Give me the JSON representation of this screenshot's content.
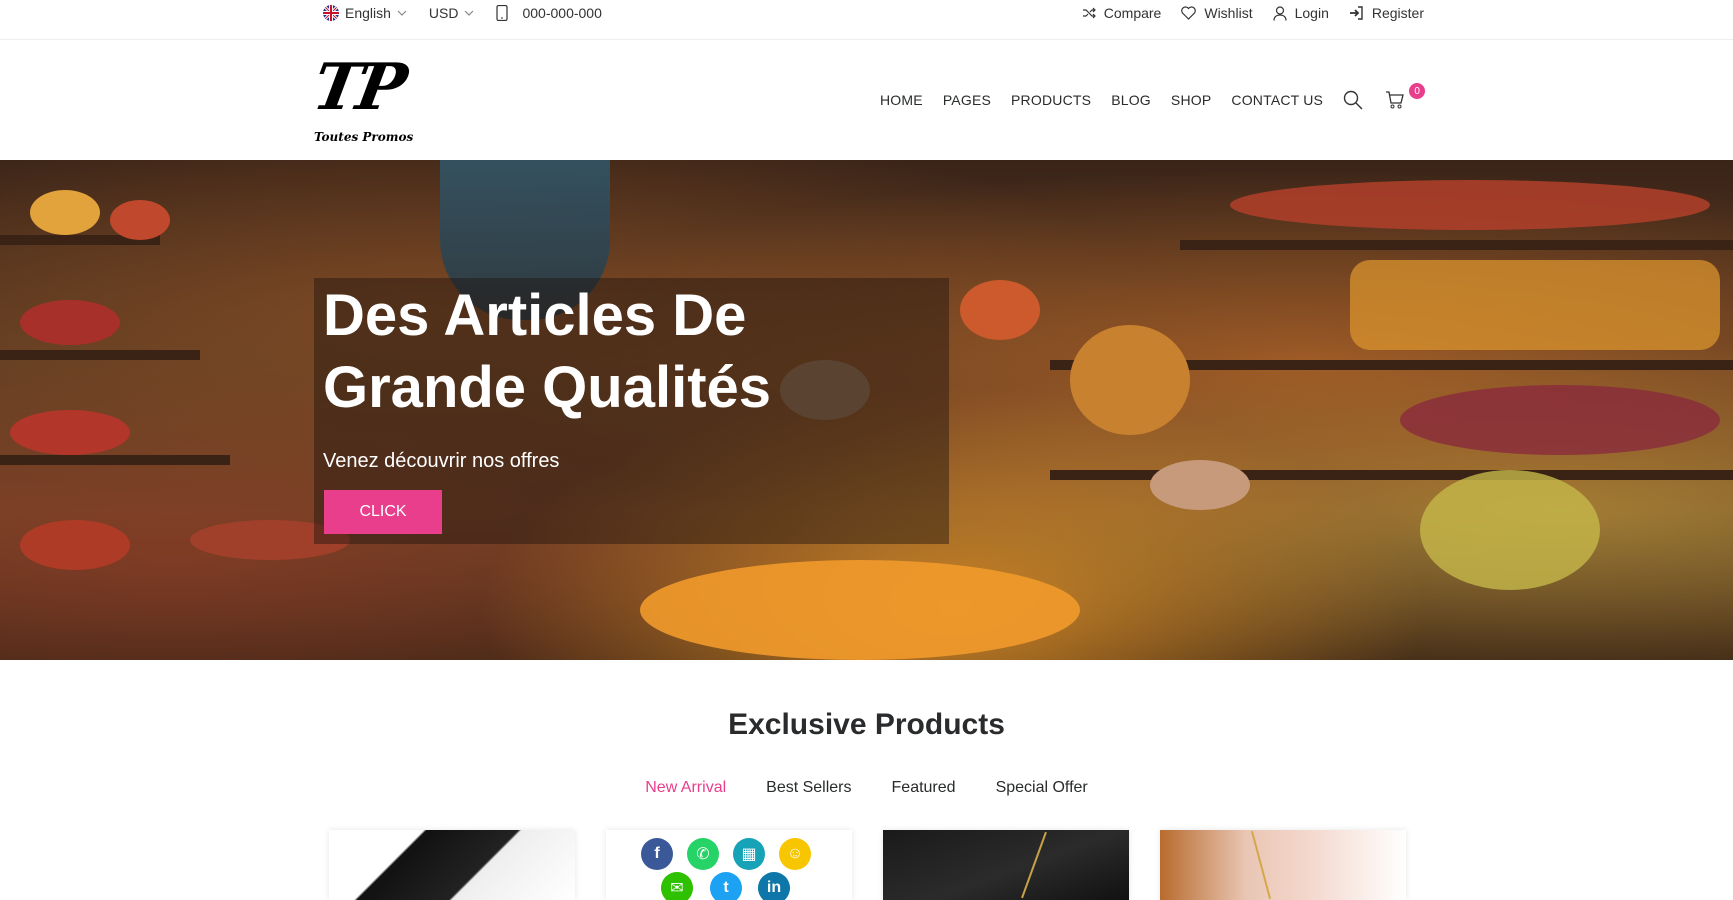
{
  "topbar": {
    "language": "English",
    "currency": "USD",
    "phone": "000-000-000",
    "links": {
      "compare": "Compare",
      "wishlist": "Wishlist",
      "login": "Login",
      "register": "Register"
    }
  },
  "logo": {
    "mark": "TP",
    "tagline": "Toutes Promos"
  },
  "nav": {
    "items": [
      "HOME",
      "PAGES",
      "PRODUCTS",
      "BLOG",
      "SHOP",
      "CONTACT US"
    ],
    "cart_count": "0"
  },
  "hero": {
    "title": "Des Articles De Grande Qualités",
    "subtitle": "Venez découvrir nos offres",
    "button": "CLICK"
  },
  "section": {
    "title": "Exclusive Products",
    "tabs": [
      "New Arrival",
      "Best Sellers",
      "Featured",
      "Special Offer"
    ],
    "active_tab": "New Arrival"
  },
  "colors": {
    "accent": "#e83e8c"
  },
  "icons": [
    "flag-uk-icon",
    "chevron-down-icon",
    "phone-icon",
    "shuffle-icon",
    "heart-icon",
    "user-icon",
    "sign-in-icon",
    "search-icon",
    "cart-icon",
    "facebook-icon",
    "whatsapp-icon",
    "snapchat-icon",
    "twitter-icon",
    "linkedin-icon",
    "wechat-icon"
  ]
}
